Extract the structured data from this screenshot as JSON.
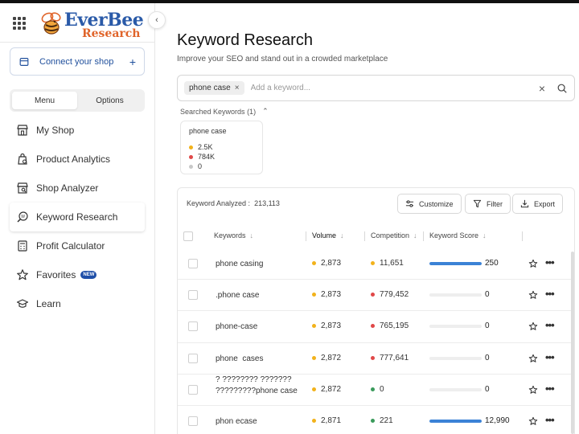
{
  "app": {
    "logo_top": "EverBee",
    "logo_bottom": "Research"
  },
  "sidebar": {
    "connect_label": "Connect your shop",
    "connect_plus": "+",
    "tabs": [
      "Menu",
      "Options"
    ],
    "items": [
      {
        "label": "My Shop",
        "icon": "store-icon"
      },
      {
        "label": "Product Analytics",
        "icon": "product-analytics-icon"
      },
      {
        "label": "Shop Analyzer",
        "icon": "shop-analyzer-icon"
      },
      {
        "label": "Keyword Research",
        "icon": "keyword-research-icon",
        "active": true
      },
      {
        "label": "Profit Calculator",
        "icon": "calculator-icon"
      },
      {
        "label": "Favorites",
        "icon": "star-icon",
        "badge": "NEW"
      },
      {
        "label": "Learn",
        "icon": "graduation-cap-icon"
      }
    ]
  },
  "header": {
    "title": "Keyword Research",
    "subtitle": "Improve your SEO and stand out in a crowded marketplace"
  },
  "search": {
    "chip": "phone case",
    "chip_close": "×",
    "placeholder": "Add a keyword...",
    "clear": "×"
  },
  "searched": {
    "label": "Searched Keywords",
    "count": "(1)",
    "card": {
      "title": "phone case",
      "stats": [
        {
          "value": "2.5K",
          "color": "#f2b21b"
        },
        {
          "value": "784K",
          "color": "#e04848"
        },
        {
          "value": "0",
          "color": "#c8c8c8"
        }
      ]
    }
  },
  "table": {
    "analyzed_label": "Keyword Analyzed :",
    "analyzed_value": "213,113",
    "buttons": {
      "customize": "Customize",
      "filter": "Filter",
      "export": "Export"
    },
    "headers": {
      "keywords": "Keywords",
      "volume": "Volume",
      "competition": "Competition",
      "score": "Keyword Score"
    },
    "rows": [
      {
        "keyword": "phone casing",
        "volume": "2,873",
        "volume_color": "#f2b21b",
        "competition": "11,651",
        "comp_color": "#f2b21b",
        "score": "250",
        "score_fraction": 1.0
      },
      {
        "keyword": ".phone case",
        "volume": "2,873",
        "volume_color": "#f2b21b",
        "competition": "779,452",
        "comp_color": "#e04848",
        "score": "0",
        "score_fraction": 0
      },
      {
        "keyword": "phone-case",
        "volume": "2,873",
        "volume_color": "#f2b21b",
        "competition": "765,195",
        "comp_color": "#e04848",
        "score": "0",
        "score_fraction": 0
      },
      {
        "keyword": "phone  cases",
        "volume": "2,872",
        "volume_color": "#f2b21b",
        "competition": "777,641",
        "comp_color": "#e04848",
        "score": "0",
        "score_fraction": 0
      },
      {
        "keyword": "? ???????? ??????? ?????????phone case",
        "volume": "2,872",
        "volume_color": "#f2b21b",
        "competition": "0",
        "comp_color": "#3a9a5b",
        "score": "0",
        "score_fraction": 0
      },
      {
        "keyword": "phon ecase",
        "volume": "2,871",
        "volume_color": "#f2b21b",
        "competition": "221",
        "comp_color": "#3a9a5b",
        "score": "12,990",
        "score_fraction": 1.0
      }
    ]
  }
}
